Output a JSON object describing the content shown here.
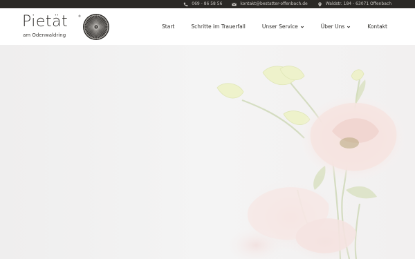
{
  "topbar": {
    "phone": "069 - 86 58 56",
    "email": "kontakt@bestatter-offenbach.de",
    "address": "Waldstr. 184 - 63071 Offenbach",
    "icons": [
      "phone-icon",
      "envelope-icon",
      "map-marker-icon"
    ]
  },
  "logo": {
    "name": "Pietät",
    "registered": "®",
    "subtitle": "am Odenwaldring"
  },
  "nav": {
    "items": [
      {
        "label": "Start"
      },
      {
        "label": "Schritte im Trauerfall"
      },
      {
        "label": "Unser Service",
        "has_dropdown": true
      },
      {
        "label": "Über Uns",
        "has_dropdown": true
      },
      {
        "label": "Kontakt"
      }
    ]
  },
  "colors": {
    "topbar_bg": "#2b2926",
    "text_dark": "#2f2d2a",
    "header_bg": "#ffffff",
    "hero_bg": "#f3f2f2"
  },
  "hero": {
    "image": "pale pink lisianthus flowers on light background"
  }
}
